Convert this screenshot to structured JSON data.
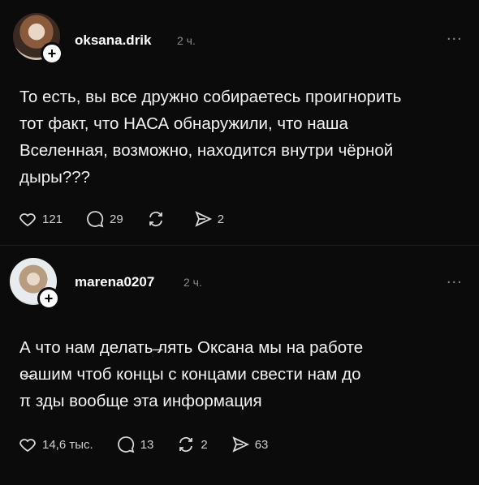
{
  "posts": [
    {
      "username": "oksana.drik",
      "time": "2 ч.",
      "more": "...",
      "text_lines": [
        "То есть, вы все дружно собираетесь проигнорить",
        "тот факт, что НАСА обнаружили, что наша",
        "Вселенная, возможно, находится внутри чёрной",
        "дыры???"
      ],
      "likes": "121",
      "replies": "29",
      "reposts": "",
      "shares": "2",
      "plus": "+"
    },
    {
      "username": "marena0207",
      "time": "2 ч.",
      "more": "...",
      "text_lines": [
        "А что нам делать ⁠̶лять  Оксана мы на работе",
        "е⁠̶ашим чтоб концы с концами свести нам до",
        "π зды вообще эта информация"
      ],
      "likes": "14,6 тыс.",
      "replies": "13",
      "reposts": "2",
      "shares": "63",
      "plus": "+"
    }
  ],
  "icons": {
    "like": "heart-icon",
    "reply": "comment-icon",
    "repost": "repost-icon",
    "share": "share-icon",
    "more": "more-icon"
  }
}
